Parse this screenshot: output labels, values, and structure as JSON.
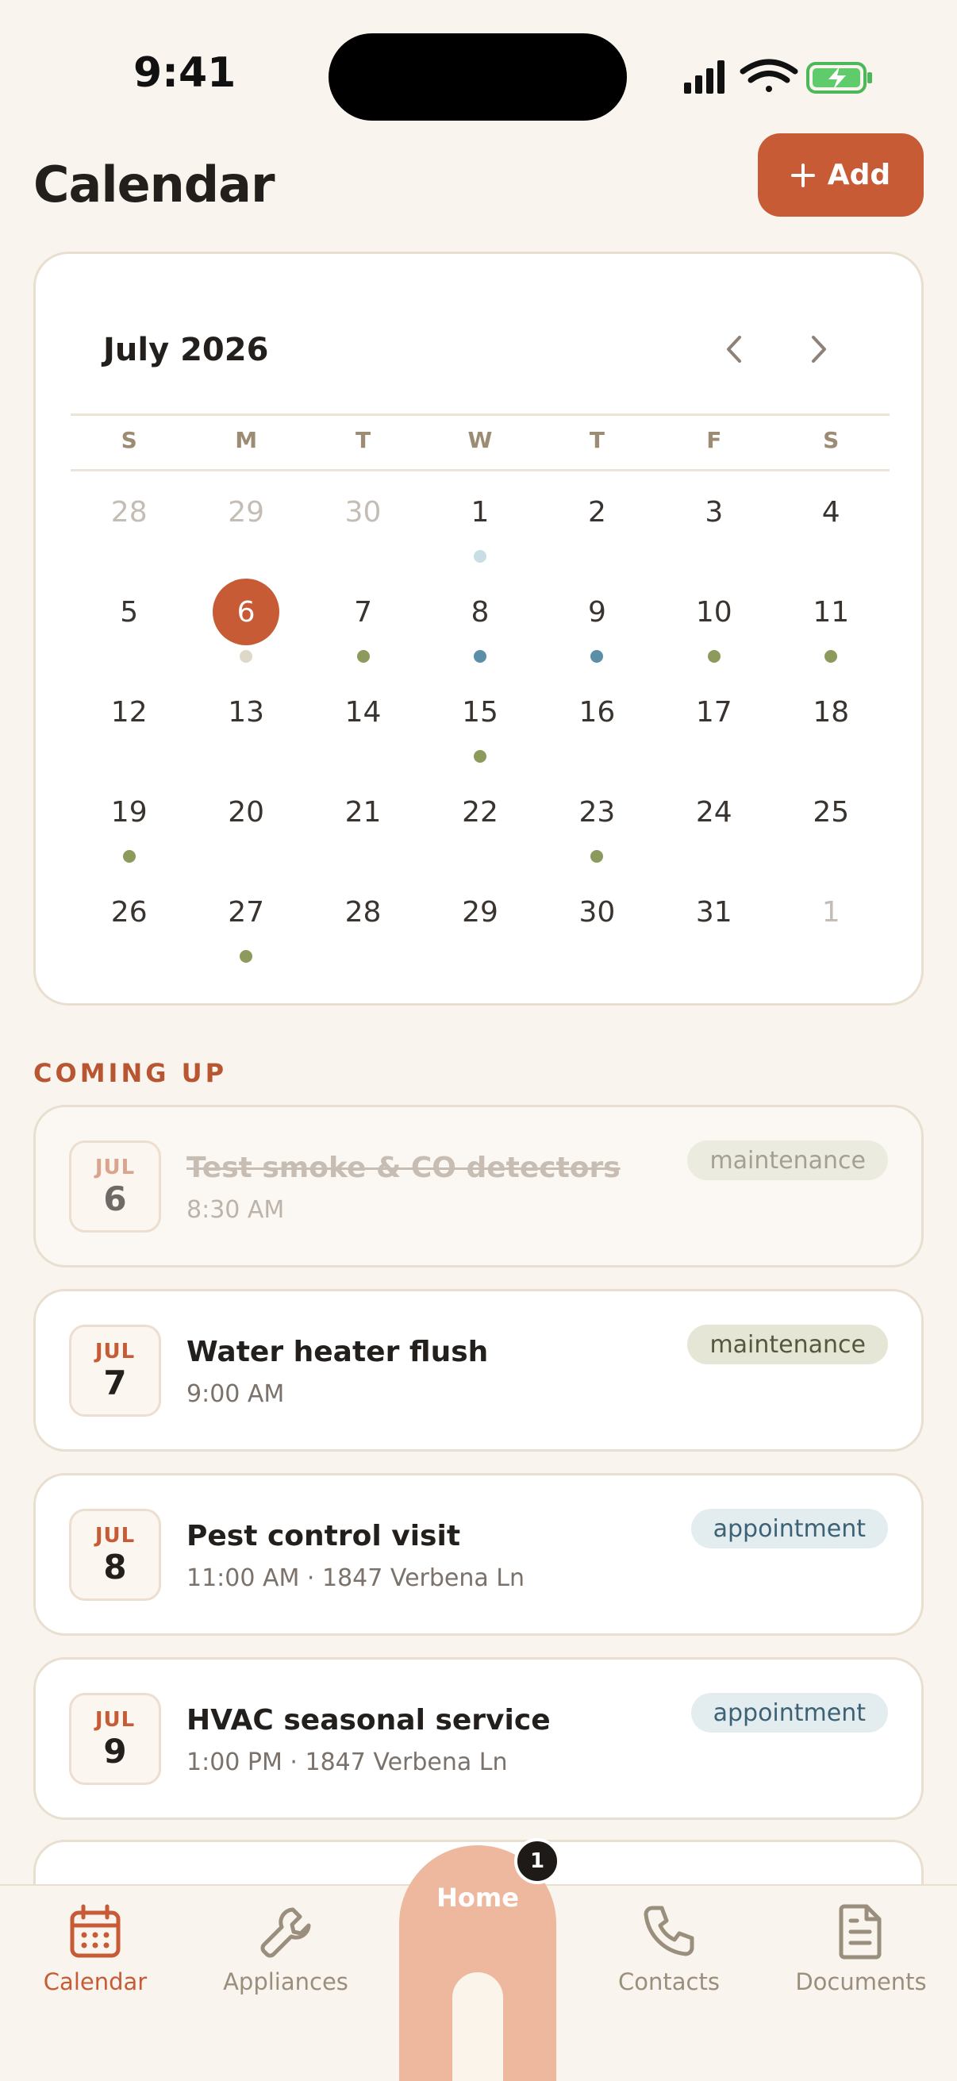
{
  "status_bar": {
    "time": "9:41"
  },
  "header": {
    "title": "Calendar",
    "add_label": "Add"
  },
  "calendar": {
    "month_label": "July 2026",
    "weekdays": [
      "S",
      "M",
      "T",
      "W",
      "T",
      "F",
      "S"
    ],
    "weeks": [
      [
        {
          "d": "28",
          "muted": true
        },
        {
          "d": "29",
          "muted": true
        },
        {
          "d": "30",
          "muted": true
        },
        {
          "d": "1",
          "dot": "#c9dde5"
        },
        {
          "d": "2"
        },
        {
          "d": "3"
        },
        {
          "d": "4"
        }
      ],
      [
        {
          "d": "5"
        },
        {
          "d": "6",
          "selected": true,
          "dot": "#ddd8c8"
        },
        {
          "d": "7",
          "dot": "#8c9a5c"
        },
        {
          "d": "8",
          "dot": "#5b8ea8"
        },
        {
          "d": "9",
          "dot": "#5b8ea8"
        },
        {
          "d": "10",
          "dot": "#8c9a5c"
        },
        {
          "d": "11",
          "dot": "#8c9a5c"
        }
      ],
      [
        {
          "d": "12"
        },
        {
          "d": "13"
        },
        {
          "d": "14"
        },
        {
          "d": "15",
          "dot": "#8c9a5c"
        },
        {
          "d": "16"
        },
        {
          "d": "17"
        },
        {
          "d": "18"
        }
      ],
      [
        {
          "d": "19",
          "dot": "#8c9a5c"
        },
        {
          "d": "20"
        },
        {
          "d": "21"
        },
        {
          "d": "22"
        },
        {
          "d": "23",
          "dot": "#8c9a5c"
        },
        {
          "d": "24"
        },
        {
          "d": "25"
        }
      ],
      [
        {
          "d": "26"
        },
        {
          "d": "27",
          "dot": "#8c9a5c"
        },
        {
          "d": "28"
        },
        {
          "d": "29"
        },
        {
          "d": "30"
        },
        {
          "d": "31"
        },
        {
          "d": "1",
          "muted": true
        }
      ]
    ]
  },
  "coming_up": {
    "label": "COMING UP",
    "events": [
      {
        "month": "JUL",
        "day": "6",
        "title": "Test smoke & CO detectors",
        "subtitle": "8:30 AM",
        "tag": "maintenance",
        "done": true
      },
      {
        "month": "JUL",
        "day": "7",
        "title": "Water heater flush",
        "subtitle": "9:00 AM",
        "tag": "maintenance",
        "done": false
      },
      {
        "month": "JUL",
        "day": "8",
        "title": "Pest control visit",
        "subtitle": "11:00 AM · 1847 Verbena Ln",
        "tag": "appointment",
        "done": false
      },
      {
        "month": "JUL",
        "day": "9",
        "title": "HVAC seasonal service",
        "subtitle": "1:00 PM · 1847 Verbena Ln",
        "tag": "appointment",
        "done": false
      }
    ]
  },
  "tab_bar": {
    "calendar": "Calendar",
    "appliances": "Appliances",
    "home": "Home",
    "home_badge": "1",
    "contacts": "Contacts",
    "documents": "Documents"
  },
  "colors": {
    "accent": "#c75b35",
    "background": "#f9f4ed",
    "maintenance_dot": "#8c9a5c",
    "appointment_dot": "#5b8ea8"
  }
}
